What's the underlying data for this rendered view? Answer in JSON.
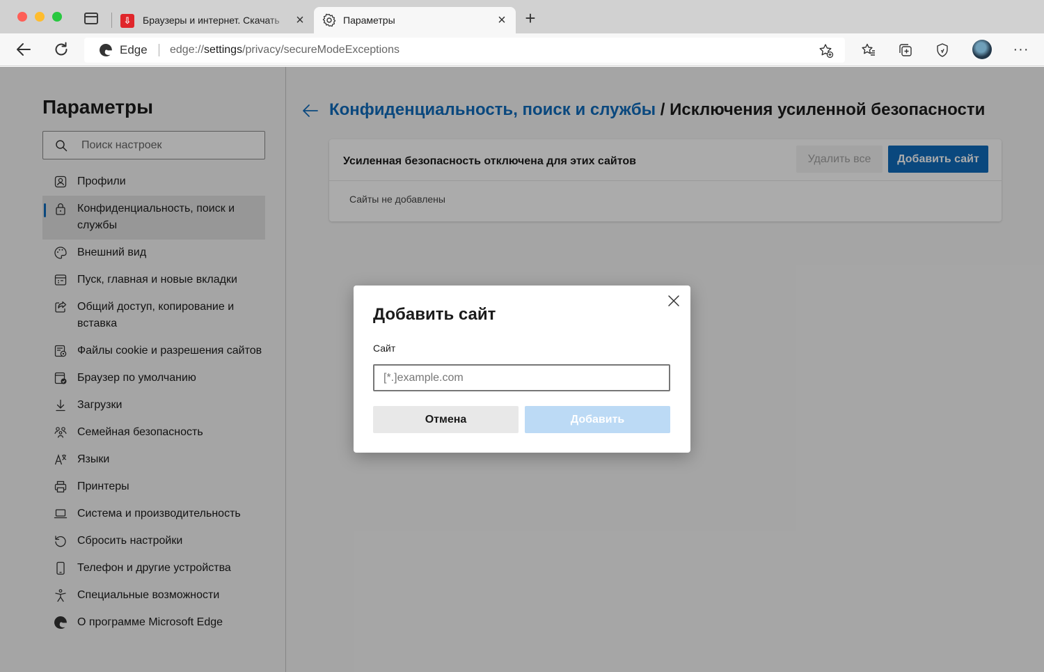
{
  "browser": {
    "tabs": [
      {
        "title": "Браузеры и интернет. Скачать",
        "favicon": "red-download-site-icon"
      },
      {
        "title": "Параметры",
        "favicon": "gear-icon"
      }
    ],
    "address": {
      "app": "Edge",
      "url_prefix": "edge://",
      "url_host": "settings",
      "url_path": "/privacy/secureModeExceptions"
    }
  },
  "settings": {
    "title": "Параметры",
    "search_placeholder": "Поиск настроек",
    "nav": [
      {
        "label": "Профили",
        "icon": "profile-icon"
      },
      {
        "label": "Конфиденциальность, поиск и службы",
        "icon": "lock-icon",
        "selected": true
      },
      {
        "label": "Внешний вид",
        "icon": "palette-icon"
      },
      {
        "label": "Пуск, главная и новые вкладки",
        "icon": "home-tabs-icon"
      },
      {
        "label": "Общий доступ, копирование и вставка",
        "icon": "share-icon"
      },
      {
        "label": "Файлы cookie и разрешения сайтов",
        "icon": "cookie-permissions-icon"
      },
      {
        "label": "Браузер по умолчанию",
        "icon": "default-browser-icon"
      },
      {
        "label": "Загрузки",
        "icon": "download-icon"
      },
      {
        "label": "Семейная безопасность",
        "icon": "family-icon"
      },
      {
        "label": "Языки",
        "icon": "languages-icon"
      },
      {
        "label": "Принтеры",
        "icon": "printer-icon"
      },
      {
        "label": "Система и производительность",
        "icon": "laptop-icon"
      },
      {
        "label": "Сбросить настройки",
        "icon": "reset-icon"
      },
      {
        "label": "Телефон и другие устройства",
        "icon": "phone-icon"
      },
      {
        "label": "Специальные возможности",
        "icon": "accessibility-icon"
      },
      {
        "label": "О программе Microsoft Edge",
        "icon": "edge-logo-icon"
      }
    ]
  },
  "main": {
    "breadcrumb_link": "Конфиденциальность, поиск и службы",
    "breadcrumb_rest": " / Исключения усиленной безопасности",
    "card_title": "Усиленная безопасность отключена для этих сайтов",
    "remove_all_label": "Удалить все",
    "add_site_label": "Добавить сайт",
    "empty_text": "Сайты не добавлены"
  },
  "dialog": {
    "title": "Добавить сайт",
    "field_label": "Сайт",
    "placeholder": "[*.]example.com",
    "cancel_label": "Отмена",
    "add_label": "Добавить"
  },
  "colors": {
    "accent": "#0f6cbd",
    "disabled_button": "#bcdaf5"
  }
}
